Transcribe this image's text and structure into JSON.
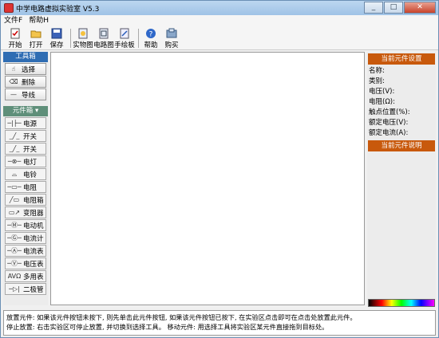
{
  "window": {
    "title": "中学电路虚拟实验室 V5.3"
  },
  "menu": [
    "文件F",
    "帮助H"
  ],
  "toolbar": [
    {
      "label": "开始",
      "icon": "new-doc-icon"
    },
    {
      "label": "打开",
      "icon": "open-folder-icon"
    },
    {
      "label": "保存",
      "icon": "save-disk-icon"
    },
    {
      "label": "实物图",
      "icon": "real-view-icon"
    },
    {
      "label": "电路图",
      "icon": "circuit-view-icon"
    },
    {
      "label": "手绘板",
      "icon": "hand-draw-icon"
    },
    {
      "label": "帮助",
      "icon": "help-icon"
    },
    {
      "label": "购买",
      "icon": "buy-icon"
    }
  ],
  "tools": {
    "header": "工具箱",
    "items": [
      {
        "label": "选择",
        "glyph": "☝"
      },
      {
        "label": "删除",
        "glyph": "⌫"
      },
      {
        "label": "导线",
        "glyph": "—"
      }
    ]
  },
  "components": {
    "header": "元件箱",
    "items": [
      {
        "label": "电源",
        "glyph": "─|├─"
      },
      {
        "label": "开关",
        "glyph": "_╱_"
      },
      {
        "label": "开关",
        "glyph": "_╱_"
      },
      {
        "label": "电灯",
        "glyph": "─⊗─"
      },
      {
        "label": "电铃",
        "glyph": "⌓"
      },
      {
        "label": "电阻",
        "glyph": "─▭─"
      },
      {
        "label": "电阻箱",
        "glyph": "╱▭"
      },
      {
        "label": "变阻器",
        "glyph": "▭↗"
      },
      {
        "label": "电动机",
        "glyph": "─Ⓜ─"
      },
      {
        "label": "电流计",
        "glyph": "─Ⓖ─"
      },
      {
        "label": "电流表",
        "glyph": "─Ⓐ─"
      },
      {
        "label": "电压表",
        "glyph": "─Ⓥ─"
      },
      {
        "label": "多用表",
        "glyph": "AVΩ"
      },
      {
        "label": "二极管",
        "glyph": "─▷|"
      }
    ]
  },
  "settings": {
    "header": "当前元件设置",
    "props": [
      "名称:",
      "类别:",
      "电压(V):",
      "电阻(Ω):",
      "触点位置(%):",
      "额定电压(V):",
      "额定电流(A):"
    ]
  },
  "description": {
    "header": "当前元件说明"
  },
  "status": {
    "line1": "放置元件: 如果该元件按钮未按下, 则先单击此元件按钮, 如果该元件按钮已按下, 在实验区点击即可在点击处放置此元件。",
    "line2": "停止放置: 右击实验区可停止放置, 并切换到选择工具。 移动元件: 用选择工具将实验区某元件直接拖到目标处。"
  }
}
